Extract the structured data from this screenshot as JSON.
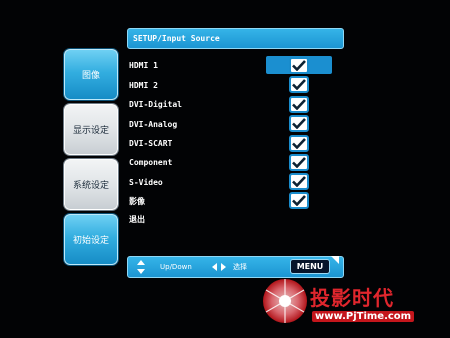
{
  "header": {
    "title": "SETUP/Input Source"
  },
  "side_menu": {
    "items": [
      {
        "label": "图像",
        "active": true
      },
      {
        "label": "显示设定",
        "active": false
      },
      {
        "label": "系统设定",
        "active": false
      },
      {
        "label": "初始设定",
        "active": true
      }
    ]
  },
  "input_sources": [
    {
      "label": "HDMI 1",
      "checked": true,
      "selected": true
    },
    {
      "label": "HDMI 2",
      "checked": true
    },
    {
      "label": "DVI-Digital",
      "checked": true
    },
    {
      "label": "DVI-Analog",
      "checked": true
    },
    {
      "label": "DVI-SCART",
      "checked": true
    },
    {
      "label": "Component",
      "checked": true
    },
    {
      "label": "S-Video",
      "checked": true
    },
    {
      "label": "影像",
      "checked": true
    },
    {
      "label": "退出",
      "checked": false
    }
  ],
  "help_bar": {
    "updown_label": "Up/Down",
    "select_label": "选择",
    "menu_label": "MENU"
  },
  "watermark": {
    "title": "投影时代",
    "url": "www.PjTime.com"
  },
  "colors": {
    "accent": "#1c95d2",
    "background": "#020305",
    "watermark_red": "#e0262d"
  }
}
